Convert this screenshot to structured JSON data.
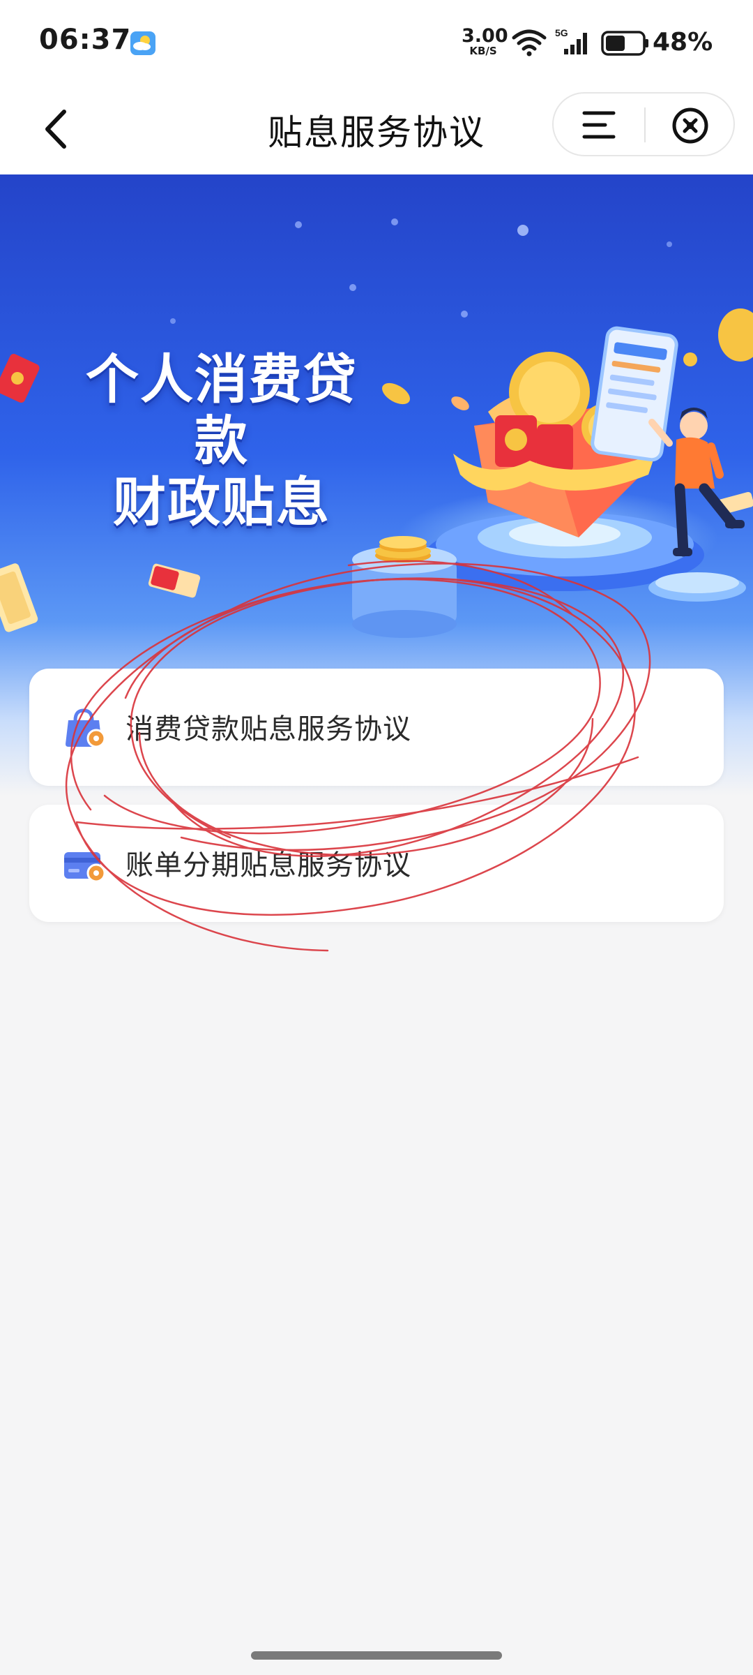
{
  "status_bar": {
    "time": "06:37",
    "network_speed_value": "3.00",
    "network_speed_unit": "KB/S",
    "signal_label": "5G",
    "battery_percent": "48%",
    "weather_icon": "partly-cloudy-icon"
  },
  "nav": {
    "title": "贴息服务协议",
    "back_icon": "chevron-left-icon",
    "menu_icon": "hamburger-menu-icon",
    "close_icon": "close-circle-icon"
  },
  "banner": {
    "title_line1": "个人消费贷款",
    "title_line2": "财政贴息"
  },
  "agreements": [
    {
      "label": "消费贷款贴息服务协议",
      "icon": "shopping-bag-icon"
    },
    {
      "label": "账单分期贴息服务协议",
      "icon": "credit-card-icon"
    }
  ],
  "colors": {
    "accent_blue": "#2f55e6",
    "banner_top": "#2146cf",
    "page_bg": "#f5f5f6",
    "scribble_red": "#d9333a",
    "icon_orange": "#f29a3a"
  }
}
